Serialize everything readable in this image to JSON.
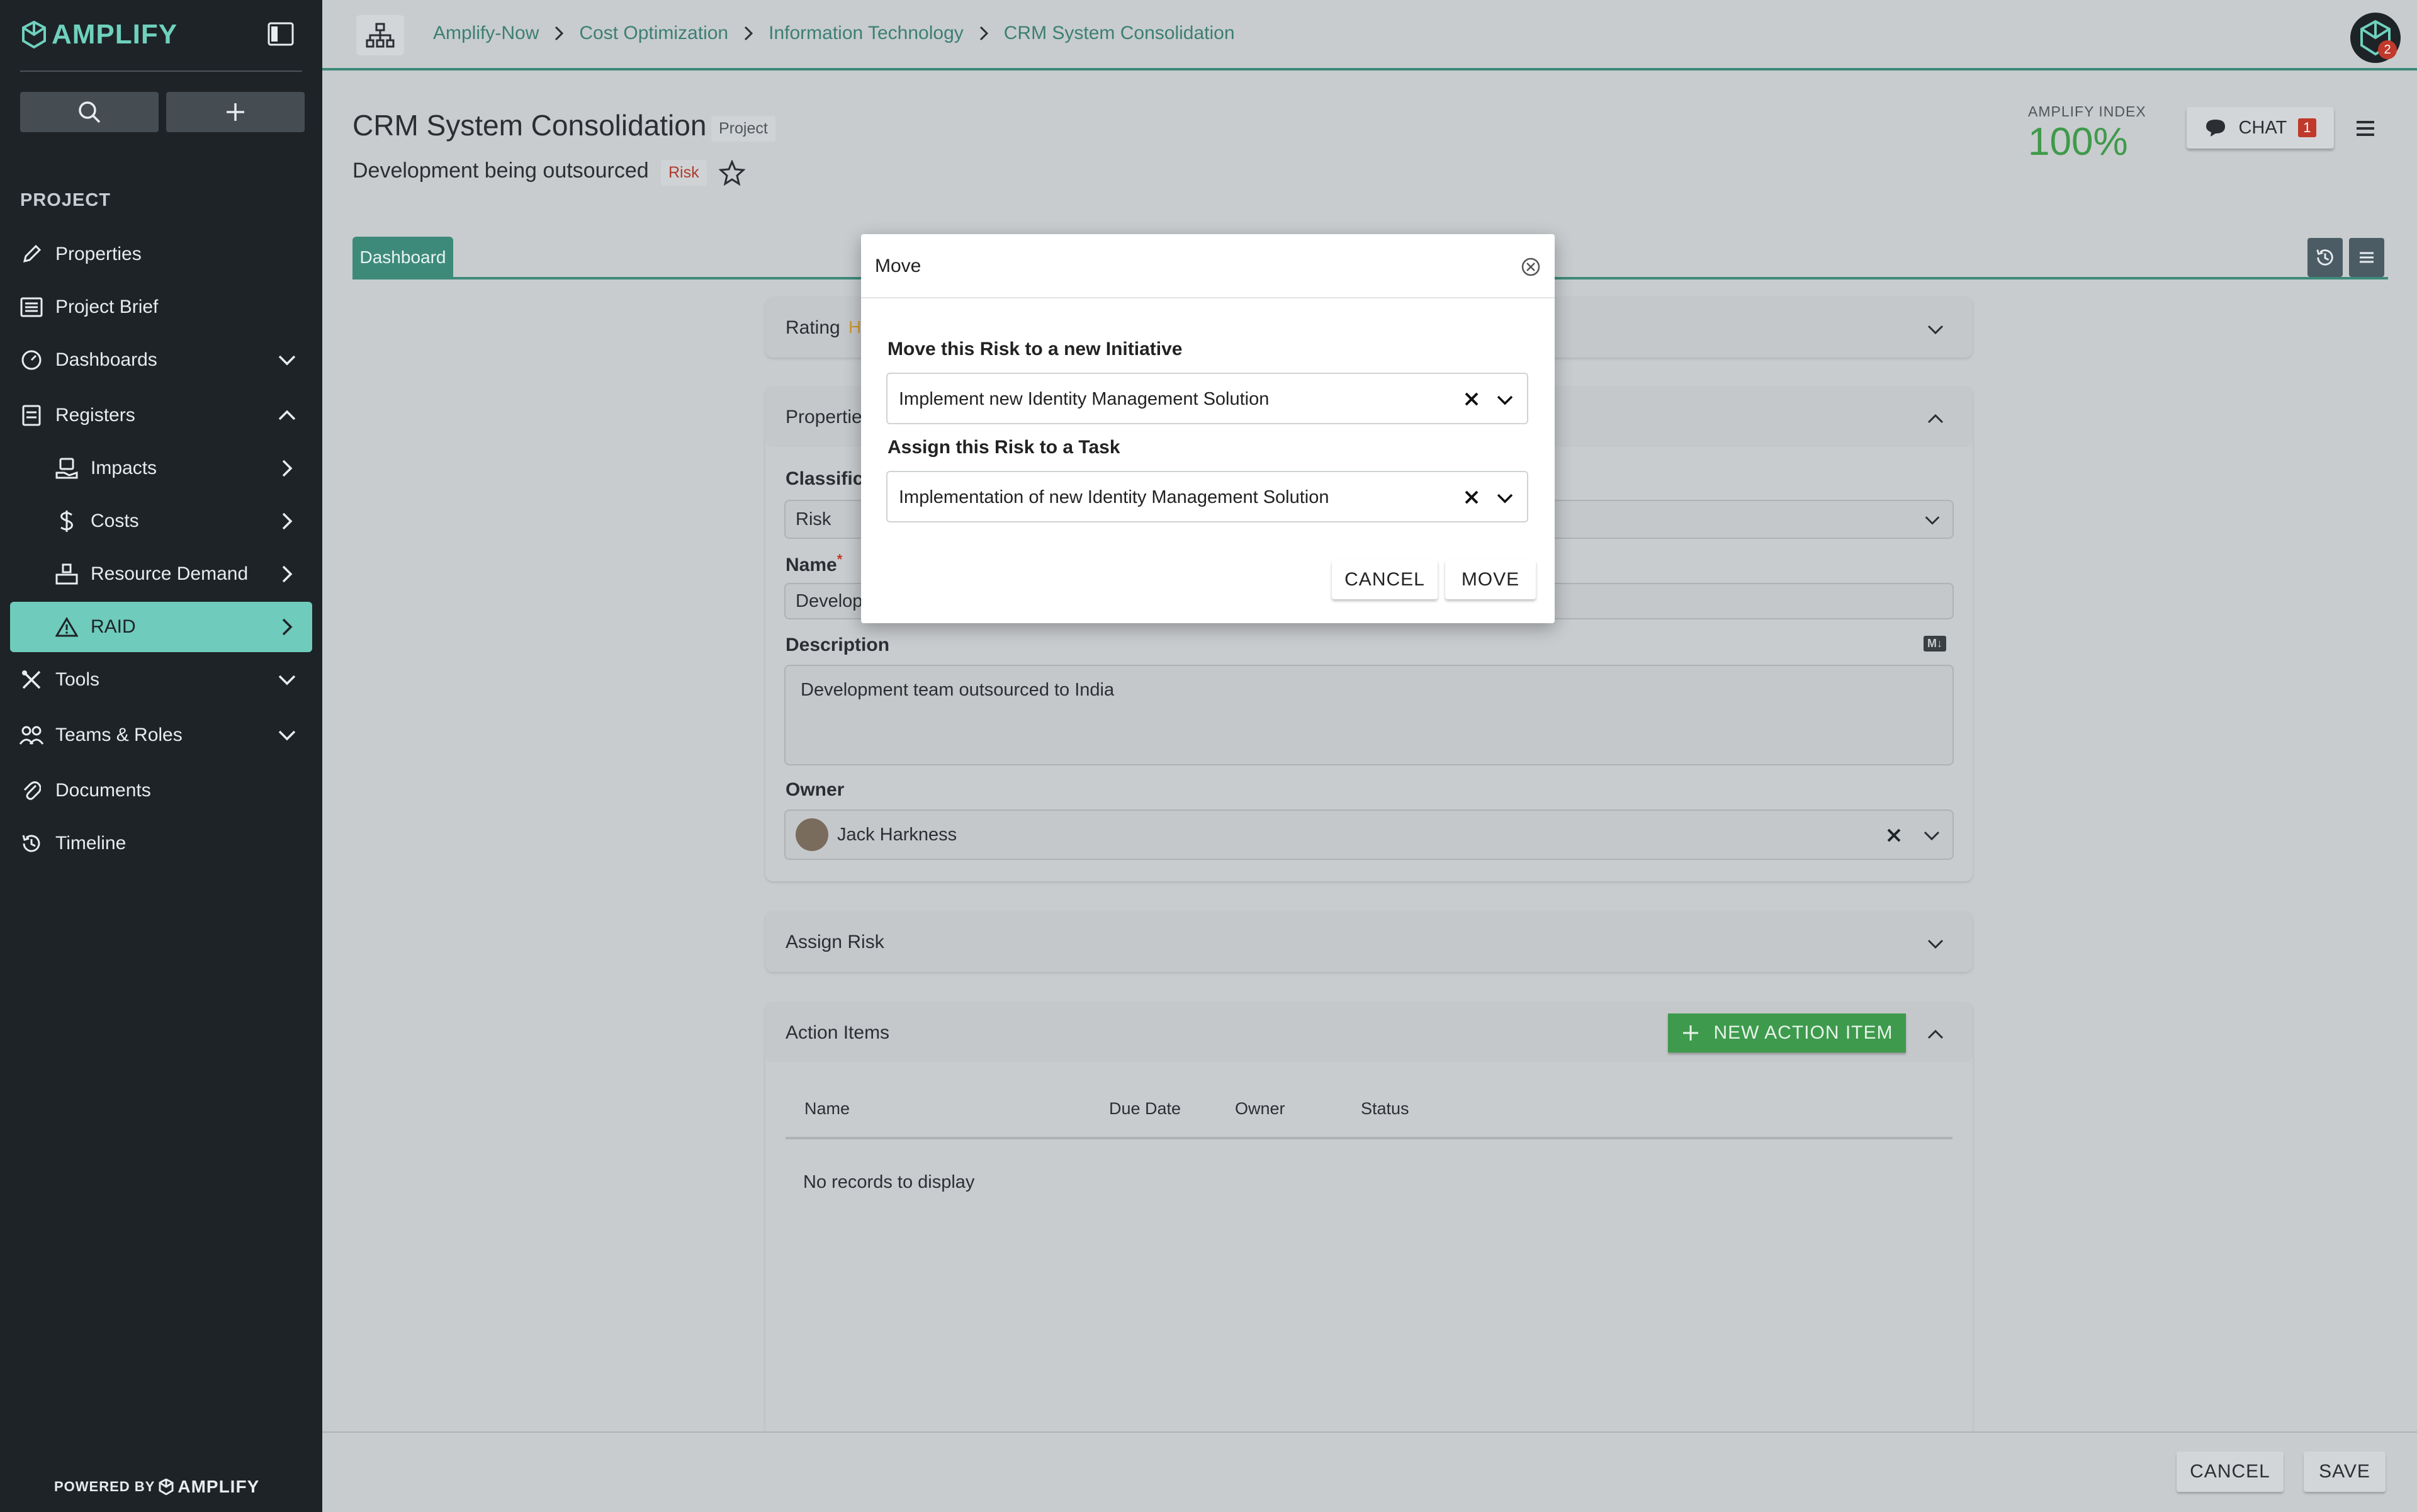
{
  "app": {
    "name": "AMPLIFY",
    "powered_by": "POWERED BY",
    "powered_brand": "AMPLIFY"
  },
  "sidebar": {
    "heading": "PROJECT",
    "items": [
      {
        "label": "Properties",
        "icon": "pencil-icon"
      },
      {
        "label": "Project Brief",
        "icon": "list-icon"
      },
      {
        "label": "Dashboards",
        "icon": "gauge-icon"
      },
      {
        "label": "Registers",
        "icon": "register-icon"
      },
      {
        "label": "Impacts",
        "icon": "hand-icon"
      },
      {
        "label": "Costs",
        "icon": "dollar-icon"
      },
      {
        "label": "Resource Demand",
        "icon": "resource-icon"
      },
      {
        "label": "RAID",
        "icon": "warning-icon"
      },
      {
        "label": "Tools",
        "icon": "tools-icon"
      },
      {
        "label": "Teams & Roles",
        "icon": "team-icon"
      },
      {
        "label": "Documents",
        "icon": "paperclip-icon"
      },
      {
        "label": "Timeline",
        "icon": "history-icon"
      }
    ]
  },
  "breadcrumb": [
    "Amplify-Now",
    "Cost Optimization",
    "Information Technology",
    "CRM System Consolidation"
  ],
  "notifications": "2",
  "header": {
    "title": "CRM System Consolidation",
    "title_tag": "Project",
    "subtitle": "Development being outsourced",
    "subtitle_tag": "Risk",
    "amplify_index_label": "AMPLIFY INDEX",
    "amplify_index_value": "100%",
    "chat_label": "CHAT",
    "chat_count": "1"
  },
  "tabs": [
    "Dashboard"
  ],
  "cards": {
    "rating": {
      "title": "Rating",
      "badge": "H"
    },
    "properties": {
      "title": "Properties",
      "classification_label": "Classification",
      "classification_value": "Risk",
      "name_label": "Name",
      "required_mark": "*",
      "name_value": "Development being outsourced",
      "description_label": "Description",
      "markdown_badge": "M↓",
      "description_value": "Development team outsourced to India",
      "owner_label": "Owner",
      "owner_value": "Jack Harkness"
    },
    "assign_risk": {
      "title": "Assign Risk"
    },
    "action_items": {
      "title": "Action Items",
      "new_button": "NEW ACTION ITEM",
      "columns": [
        "Name",
        "Due Date",
        "Owner",
        "Status"
      ],
      "empty_text": "No records to display"
    }
  },
  "footer": {
    "cancel": "CANCEL",
    "save": "SAVE"
  },
  "modal": {
    "title": "Move",
    "initiative_label": "Move this Risk to a new Initiative",
    "initiative_value": "Implement new Identity Management Solution",
    "task_label": "Assign this Risk to a Task",
    "task_value": "Implementation of new Identity Management Solution",
    "cancel": "CANCEL",
    "move": "MOVE"
  },
  "colors": {
    "brand_teal": "#6fcbbb",
    "accent_green": "#3e8a7a",
    "index_green": "#3f9a4b",
    "alert_red": "#c0392b",
    "sidebar_bg": "#1e2327"
  }
}
